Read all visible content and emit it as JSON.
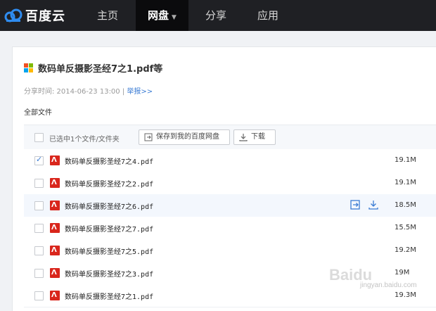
{
  "brand": {
    "name": "百度云"
  },
  "nav": {
    "items": [
      {
        "label": "主页"
      },
      {
        "label": "网盘",
        "active": true
      },
      {
        "label": "分享"
      },
      {
        "label": "应用"
      }
    ]
  },
  "share": {
    "title": "数码单反摄影圣经7之1.pdf等",
    "share_time_label": "分享时间: 2014-06-23 13:00",
    "separator": "|",
    "report_label": "举报>>"
  },
  "all_files_label": "全部文件",
  "toolbar": {
    "selection_text": "已选中1个文件/文件夹",
    "save_label": "保存到我的百度网盘",
    "download_label": "下载"
  },
  "files": [
    {
      "name": "数码单反摄影圣经7之4.pdf",
      "size": "19.1M",
      "checked": true
    },
    {
      "name": "数码单反摄影圣经7之2.pdf",
      "size": "19.1M",
      "checked": false
    },
    {
      "name": "数码单反摄影圣经7之6.pdf",
      "size": "18.5M",
      "checked": false,
      "hover": true
    },
    {
      "name": "数码单反摄影圣经7之7.pdf",
      "size": "15.5M",
      "checked": false
    },
    {
      "name": "数码单反摄影圣经7之5.pdf",
      "size": "19.2M",
      "checked": false
    },
    {
      "name": "数码单反摄影圣经7之3.pdf",
      "size": "19M",
      "checked": false
    },
    {
      "name": "数码单反摄影圣经7之1.pdf",
      "size": "19.3M",
      "checked": false
    }
  ],
  "watermark": {
    "text": "Baidu",
    "sub": "jingyan.baidu.com"
  },
  "colors": {
    "topbar": "#1f2024",
    "accent": "#3b7cd4",
    "pdf": "#d9261c"
  }
}
